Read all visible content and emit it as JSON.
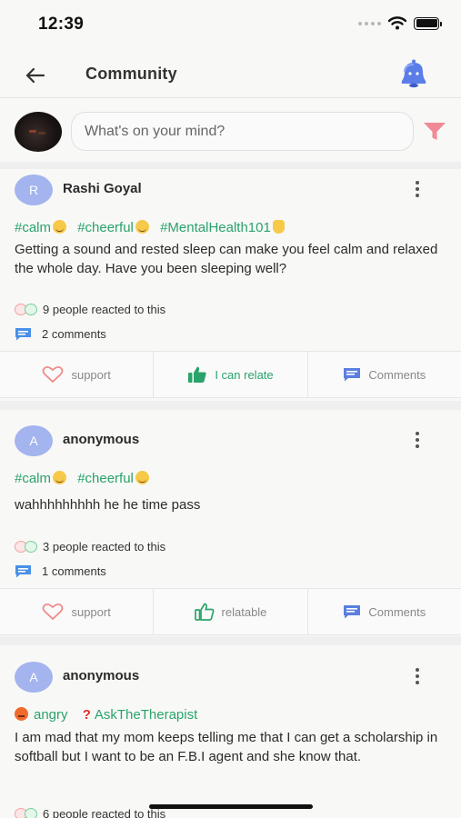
{
  "status": {
    "time": "12:39"
  },
  "header": {
    "title": "Community"
  },
  "compose": {
    "placeholder": "What's on your mind?"
  },
  "posts": [
    {
      "author": "Rashi Goyal",
      "initial": "R",
      "tags": [
        "#calm",
        "#cheerful",
        "#MentalHealth101"
      ],
      "body": "Getting a sound and rested sleep can make you feel calm and relaxed the whole day. Have you been sleeping well?",
      "reactions": "9 people reacted to this",
      "comments": "2 comments",
      "actions": {
        "support": "support",
        "relate": "I can relate",
        "comments": "Comments"
      }
    },
    {
      "author": "anonymous",
      "initial": "A",
      "tags": [
        "#calm",
        "#cheerful"
      ],
      "body": "wahhhhhhhhh he he time pass",
      "reactions": "3 people reacted to this",
      "comments": "1 comments",
      "actions": {
        "support": "support",
        "relate": "relatable",
        "comments": "Comments"
      }
    },
    {
      "author": "anonymous",
      "initial": "A",
      "tags": [
        "angry",
        "AskTheTherapist"
      ],
      "body": "I am mad that my mom keeps telling me that I can get a scholarship in softball but I want to be an F.B.I agent and she know that.",
      "reactions": "6 people reacted to this"
    }
  ],
  "icons": {
    "back": "arrow-left-icon",
    "bell": "bell-icon",
    "filter": "funnel-icon",
    "more": "kebab-icon"
  },
  "colors": {
    "accent_green": "#2aa36b",
    "bell_blue": "#5b7de8",
    "filter_pink": "#f08a95",
    "comment_blue": "#4a8fe8",
    "avatar_lilac": "#a3b4ef"
  }
}
